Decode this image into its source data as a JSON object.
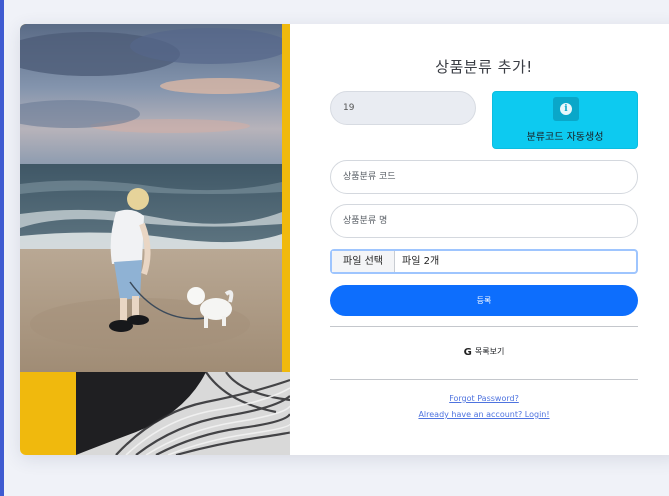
{
  "form": {
    "title": "상품분류 추가!",
    "code_value": "19",
    "auto_button": {
      "label": "분류코드 자동생성",
      "icon": "info-icon",
      "color": "#0dcaf0"
    },
    "code_placeholder": "상품분류 코드",
    "name_placeholder": "상품분류 명",
    "file": {
      "button_label": "파일 선택",
      "status": "파일 2개"
    },
    "submit_label": "등록",
    "list_link": {
      "icon": "google-icon",
      "label": "목록보기"
    },
    "forgot_password": "Forgot Password?",
    "login_link": "Already have an account? Login!"
  },
  "colors": {
    "primary": "#0d6efd",
    "info": "#0dcaf0",
    "link": "#4e73df",
    "panel_accent": "#f0b90d"
  }
}
